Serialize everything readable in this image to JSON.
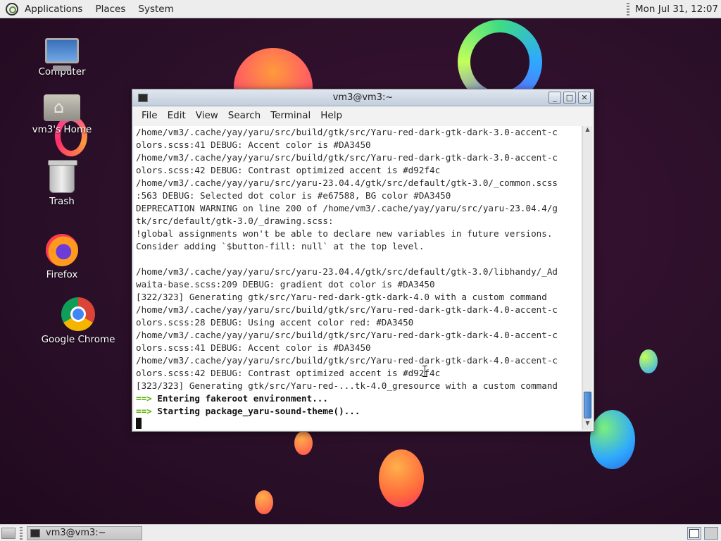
{
  "top_panel": {
    "menus": [
      "Applications",
      "Places",
      "System"
    ],
    "clock": "Mon Jul 31, 12:07"
  },
  "desktop": {
    "icons": [
      {
        "label": "Computer",
        "icon": "computer-icon"
      },
      {
        "label": "vm3's Home",
        "icon": "home-folder-icon"
      },
      {
        "label": "Trash",
        "icon": "trash-icon"
      },
      {
        "label": "Firefox",
        "icon": "firefox-icon"
      },
      {
        "label": "Google Chrome",
        "icon": "chrome-icon"
      }
    ]
  },
  "terminal": {
    "title": "vm3@vm3:~",
    "menu": [
      "File",
      "Edit",
      "View",
      "Search",
      "Terminal",
      "Help"
    ],
    "window_buttons": {
      "minimize": "_",
      "maximize": "□",
      "close": "✕"
    },
    "lines": [
      "/home/vm3/.cache/yay/yaru/src/build/gtk/src/Yaru-red-dark-gtk-dark-3.0-accent-c",
      "olors.scss:41 DEBUG: Accent color is #DA3450",
      "/home/vm3/.cache/yay/yaru/src/build/gtk/src/Yaru-red-dark-gtk-dark-3.0-accent-c",
      "olors.scss:42 DEBUG: Contrast optimized accent is #d92f4c",
      "/home/vm3/.cache/yay/yaru/src/yaru-23.04.4/gtk/src/default/gtk-3.0/_common.scss",
      ":563 DEBUG: Selected dot color is #e67588, BG color #DA3450",
      "DEPRECATION WARNING on line 200 of /home/vm3/.cache/yay/yaru/src/yaru-23.04.4/g",
      "tk/src/default/gtk-3.0/_drawing.scss:",
      "!global assignments won't be able to declare new variables in future versions.",
      "Consider adding `$button-fill: null` at the top level.",
      "",
      "/home/vm3/.cache/yay/yaru/src/yaru-23.04.4/gtk/src/default/gtk-3.0/libhandy/_Ad",
      "waita-base.scss:209 DEBUG: gradient dot color is #DA3450",
      "[322/323] Generating gtk/src/Yaru-red-dark-gtk-dark-4.0 with a custom command",
      "/home/vm3/.cache/yay/yaru/src/build/gtk/src/Yaru-red-dark-gtk-dark-4.0-accent-c",
      "olors.scss:28 DEBUG: Using accent color red: #DA3450",
      "/home/vm3/.cache/yay/yaru/src/build/gtk/src/Yaru-red-dark-gtk-dark-4.0-accent-c",
      "olors.scss:41 DEBUG: Accent color is #DA3450",
      "/home/vm3/.cache/yay/yaru/src/build/gtk/src/Yaru-red-dark-gtk-dark-4.0-accent-c",
      "olors.scss:42 DEBUG: Contrast optimized accent is #d92f4c",
      "[323/323] Generating gtk/src/Yaru-red-...tk-4.0_gresource with a custom command"
    ],
    "status_lines": [
      {
        "arrow": "==>",
        "text": "Entering fakeroot environment..."
      },
      {
        "arrow": "==>",
        "text": "Starting package_yaru-sound-theme()..."
      }
    ],
    "arrow_color": "#5ab000",
    "scroll_position": 1.0
  },
  "bottom_panel": {
    "task_label": "vm3@vm3:~",
    "workspaces": 2
  }
}
